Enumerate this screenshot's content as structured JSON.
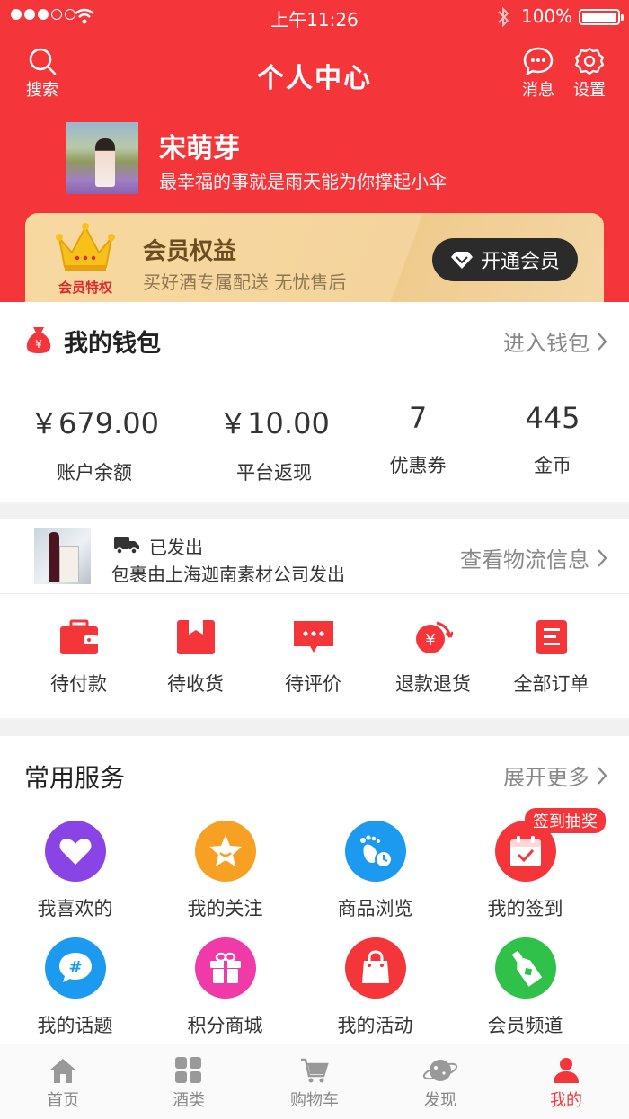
{
  "status_bar": {
    "time": "上午11:26",
    "battery": "100%"
  },
  "header": {
    "title": "个人中心",
    "search_label": "搜索",
    "message_label": "消息",
    "settings_label": "设置"
  },
  "profile": {
    "name": "宋萌芽",
    "motto": "最幸福的事就是雨天能为你撑起小伞"
  },
  "vip": {
    "badge_caption": "会员特权",
    "title": "会员权益",
    "subtitle": "买好酒专属配送  无忧售后",
    "button_label": "开通会员"
  },
  "wallet": {
    "title": "我的钱包",
    "more_label": "进入钱包",
    "stats": [
      {
        "value": "￥679.00",
        "label": "账户余额"
      },
      {
        "value": "￥10.00",
        "label": "平台返现"
      },
      {
        "value": "7",
        "label": "优惠券"
      },
      {
        "value": "445",
        "label": "金币"
      }
    ]
  },
  "shipping": {
    "status": "已发出",
    "description": "包裹由上海迦南素材公司发出",
    "more_label": "查看物流信息"
  },
  "orders": {
    "items": [
      {
        "label": "待付款",
        "icon": "wallet-icon"
      },
      {
        "label": "待收货",
        "icon": "package-icon"
      },
      {
        "label": "待评价",
        "icon": "comment-icon"
      },
      {
        "label": "退款退货",
        "icon": "refund-icon"
      },
      {
        "label": "全部订单",
        "icon": "order-list-icon"
      }
    ]
  },
  "services": {
    "title": "常用服务",
    "more_label": "展开更多",
    "badge": "签到抽奖",
    "items": [
      {
        "label": "我喜欢的",
        "icon": "heart-icon",
        "color": "#8a44e6"
      },
      {
        "label": "我的关注",
        "icon": "star-icon",
        "color": "#f8a023"
      },
      {
        "label": "商品浏览",
        "icon": "footprint-icon",
        "color": "#1b9af0"
      },
      {
        "label": "我的签到",
        "icon": "calendar-check-icon",
        "color": "#f4363b"
      },
      {
        "label": "我的话题",
        "icon": "hashtag-chat-icon",
        "color": "#1b9af0"
      },
      {
        "label": "积分商城",
        "icon": "gift-icon",
        "color": "#f03aa8"
      },
      {
        "label": "我的活动",
        "icon": "shopping-bag-icon",
        "color": "#f4363b"
      },
      {
        "label": "会员频道",
        "icon": "wine-bottle-icon",
        "color": "#2fc14a"
      }
    ]
  },
  "tabbar": {
    "items": [
      {
        "label": "首页",
        "icon": "home-icon"
      },
      {
        "label": "酒类",
        "icon": "grid-icon"
      },
      {
        "label": "购物车",
        "icon": "cart-icon"
      },
      {
        "label": "发现",
        "icon": "planet-icon"
      },
      {
        "label": "我的",
        "icon": "person-icon",
        "active": true
      }
    ]
  },
  "colors": {
    "brand_red": "#f4363b",
    "vip_gold": "#f4d49c",
    "text_gray": "#888888"
  }
}
